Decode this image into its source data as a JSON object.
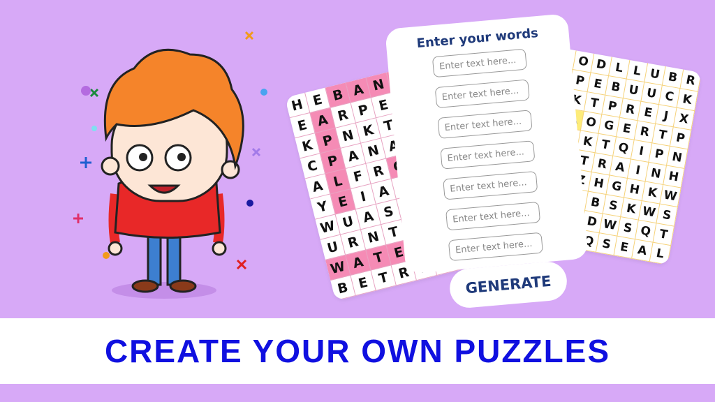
{
  "card": {
    "title": "Enter your words",
    "placeholder": "Enter text here...",
    "input_count": 7
  },
  "generate_label": "GENERATE",
  "banner": "CREATE YOUR OWN PUZZLES",
  "pink_grid": {
    "color": "#f58bb5",
    "rows": [
      "HEBANAN",
      "EARPEBU",
      "KPNKTBR",
      "CPANAEC",
      "ALFRGRR",
      "YEIACRY",
      "WUASYCP",
      "URNTCPM",
      "WATERMX",
      "BETREXK"
    ],
    "highlight": [
      [
        0,
        2
      ],
      [
        0,
        3
      ],
      [
        0,
        4
      ],
      [
        0,
        5
      ],
      [
        0,
        6
      ],
      [
        1,
        1
      ],
      [
        2,
        1
      ],
      [
        3,
        1
      ],
      [
        4,
        1
      ],
      [
        5,
        1
      ],
      [
        2,
        5
      ],
      [
        3,
        5
      ],
      [
        4,
        4
      ],
      [
        4,
        5
      ],
      [
        5,
        5
      ],
      [
        8,
        0
      ],
      [
        8,
        1
      ],
      [
        8,
        2
      ],
      [
        8,
        3
      ],
      [
        8,
        4
      ],
      [
        8,
        5
      ]
    ]
  },
  "yellow_grid": {
    "color": "#fdec7a",
    "rows": [
      "ZODLLUBR",
      "RPEBUUCK",
      "NKTPREJX",
      "NAOGERTP",
      "RIKTQIPN",
      "ACTRAINH",
      "YOZHGHKW",
      "CPSBSKWS",
      "CHUDWSQT",
      "XBGQSEAL"
    ],
    "highlight": [
      [
        2,
        0
      ],
      [
        3,
        0
      ],
      [
        3,
        1
      ],
      [
        8,
        0
      ],
      [
        8,
        1
      ]
    ]
  }
}
